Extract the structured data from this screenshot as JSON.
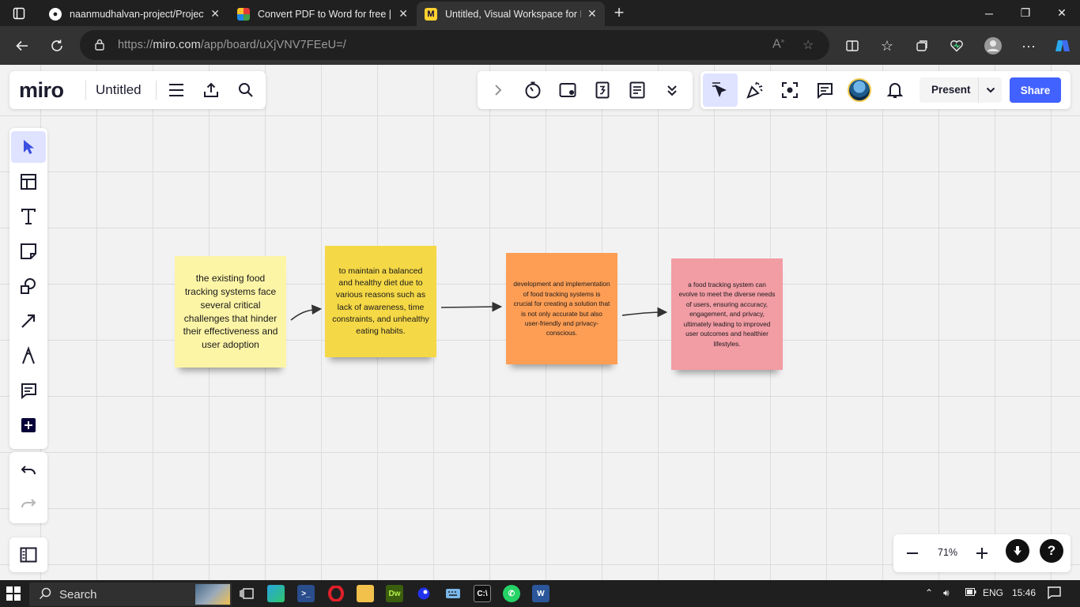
{
  "browser": {
    "tabs": [
      {
        "title": "naanmudhalvan-project/ProjectP",
        "favicon": "github-icon",
        "active": false
      },
      {
        "title": "Convert PDF to Word for free | Sr",
        "favicon": "smallpdf-icon",
        "active": false
      },
      {
        "title": "Untitled, Visual Workspace for In",
        "favicon": "miro-icon",
        "active": true
      }
    ],
    "url_prefix": "https://",
    "url_host": "miro.com",
    "url_path": "/app/board/uXjVNV7FEeU=/"
  },
  "miro": {
    "logo": "miro",
    "board_title": "Untitled",
    "present_label": "Present",
    "share_label": "Share",
    "zoom_level": "71%",
    "help_label": "?"
  },
  "notes": [
    {
      "text": "the existing food tracking systems face several critical challenges that hinder their effectiveness and user adoption",
      "color": "#fdf5a6"
    },
    {
      "text": "to maintain a balanced and healthy diet due to various reasons such as lack of awareness, time constraints, and unhealthy eating habits.",
      "color": "#f5d846"
    },
    {
      "text": "development and implementation of food tracking systems is crucial for creating a solution that is not only accurate but also user-friendly and privacy-conscious.",
      "color": "#fe9e55"
    },
    {
      "text": "a food tracking system can evolve to meet the diverse needs of users, ensuring accuracy, engagement, and privacy, ultimately leading to improved user outcomes and healthier lifestyles.",
      "color": "#f29ca4"
    }
  ],
  "taskbar": {
    "search_label": "Search",
    "language": "ENG",
    "time": "15:46"
  }
}
